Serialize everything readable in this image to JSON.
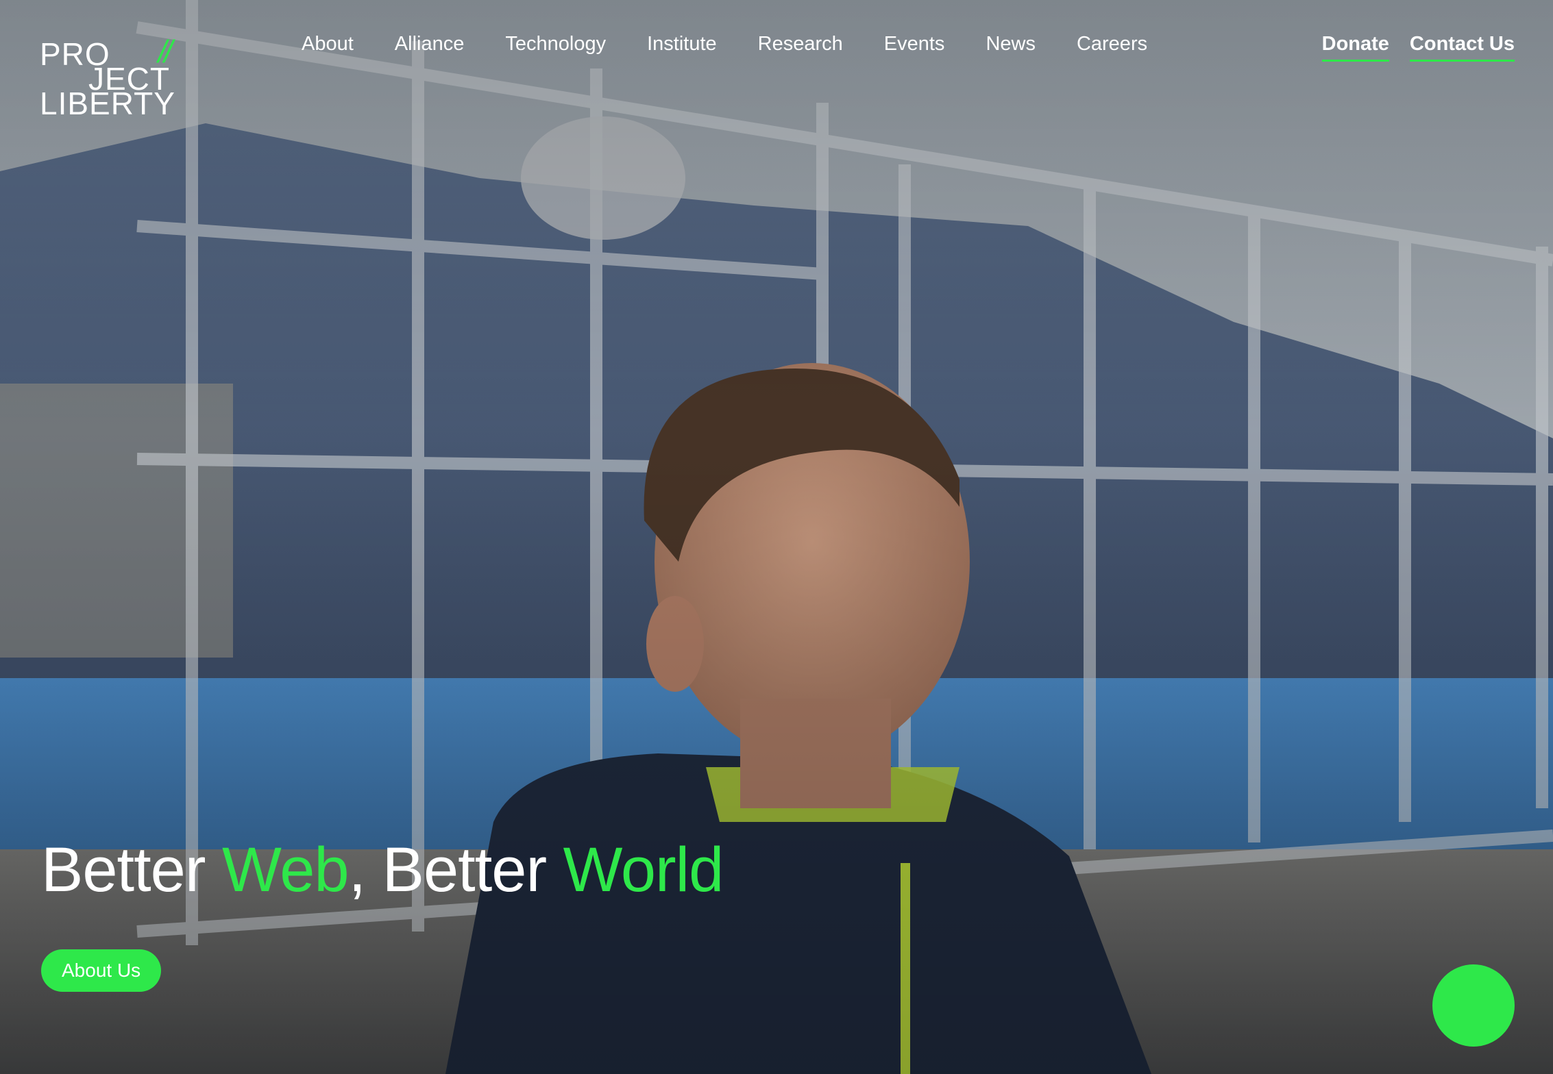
{
  "brand": {
    "logo_line1": "PRO",
    "logo_slashes": "//",
    "logo_line2": "JECT",
    "logo_line3": "LIBERTY",
    "accent_color": "#2ee84a"
  },
  "nav": {
    "items": [
      {
        "label": "About"
      },
      {
        "label": "Alliance"
      },
      {
        "label": "Technology"
      },
      {
        "label": "Institute"
      },
      {
        "label": "Research"
      },
      {
        "label": "Events"
      },
      {
        "label": "News"
      },
      {
        "label": "Careers"
      }
    ],
    "donate_label": "Donate",
    "contact_label": "Contact Us"
  },
  "hero": {
    "headline_part1": "Better ",
    "headline_accent1": "Web",
    "headline_part2": ", Better ",
    "headline_accent2": "World",
    "cta_label": "About Us",
    "image_subject": "boy-in-navy-puffer-jacket-basketball-court"
  },
  "floating_action": {
    "icon": "circle-button",
    "color": "#2ee84a"
  }
}
